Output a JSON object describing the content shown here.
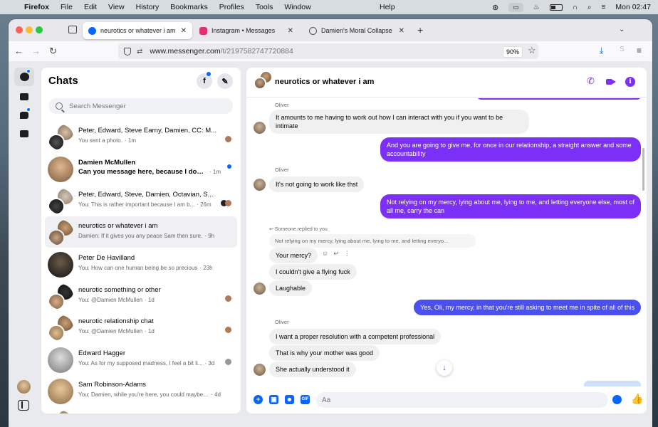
{
  "menubar": {
    "app": "Firefox",
    "items": [
      "File",
      "Edit",
      "View",
      "History",
      "Bookmarks",
      "Profiles",
      "Tools",
      "Window"
    ],
    "help": "Help",
    "clock": "Mon 02:47"
  },
  "browser": {
    "tabs": [
      {
        "title": "neurotics or whatever i am | Me",
        "favicon_color": "#0866ff"
      },
      {
        "title": "Instagram • Messages",
        "favicon_color": "#e1306c"
      },
      {
        "title": "Damien's Moral Collapse",
        "favicon_color": "#555555"
      }
    ],
    "url_host": "www.messenger.com",
    "url_path": "/t/2197582747720884",
    "zoom": "90%"
  },
  "chats": {
    "title": "Chats",
    "search_placeholder": "Search Messenger",
    "items": [
      {
        "name": "Peter, Edward, Steve Earny, Damien, CC: M...",
        "preview": "You sent a photo.",
        "time": "· 1m",
        "unread": false
      },
      {
        "name": "Damien McMullen",
        "preview": "Can you message here, because I don't...",
        "time": "· 1m",
        "unread": true
      },
      {
        "name": "Peter, Edward, Steve, Damien, Octavian, S...",
        "preview": "You: This is rather important because I am b...",
        "time": "· 26m",
        "unread": false
      },
      {
        "name": "neurotics or whatever i am",
        "preview": "Damien: If it gives you any peace Sam then sure.",
        "time": "· 9h",
        "unread": false
      },
      {
        "name": "Peter De Havilland",
        "preview": "You: How can one human being be so precious",
        "time": "· 23h",
        "unread": false
      },
      {
        "name": "neurotic something or other",
        "preview": "You: @Damien McMullen",
        "time": "· 1d",
        "unread": false
      },
      {
        "name": "neurotic relationship chat",
        "preview": "You: @Damien McMullen",
        "time": "· 1d",
        "unread": false
      },
      {
        "name": "Edward Hagger",
        "preview": "You: As for my supposed madness, I feel a bit li...",
        "time": "· 3d",
        "unread": false
      },
      {
        "name": "Sam Robinson-Adams",
        "preview": "You: Damien, while you're here, you could maybe: ...",
        "time": "· 4d",
        "unread": false
      }
    ]
  },
  "conversation": {
    "title": "neurotics or whatever i am",
    "sender_1": "Oliver",
    "msg_1": "It amounts to me having to work out how I can interact with you if you want to be intimate",
    "msg_2": "And you are going to give me, for once in our relationship, a straight answer and some accountability",
    "sender_2": "Oliver",
    "msg_3": "It's not going to work like thst",
    "msg_4": "Not relying on my mercy, lying about me, lying to me, and letting everyone else, most of all me, carry the can",
    "reply_note": "Someone replied to you",
    "quoted": "Not relying on my mercy, lying about me, lying to me, and letting everyo...",
    "msg_5": "Your mercy?",
    "msg_6": "I couldn't give a flying fuck",
    "msg_7": "Laughable",
    "msg_8": "Yes, Oli, my mercy, in that you're still asking to meet me in spite of all of this",
    "sender_3": "Oliver",
    "msg_9": "I want a proper resolution with a competent professional",
    "msg_10": "That is why your mother was good",
    "msg_11": "She actually understood it",
    "composer_placeholder": "Aa"
  },
  "colors": {
    "accent_purple": "#7b2ff7",
    "accent_blue": "#4a4ff0",
    "messenger_blue": "#0866ff"
  }
}
